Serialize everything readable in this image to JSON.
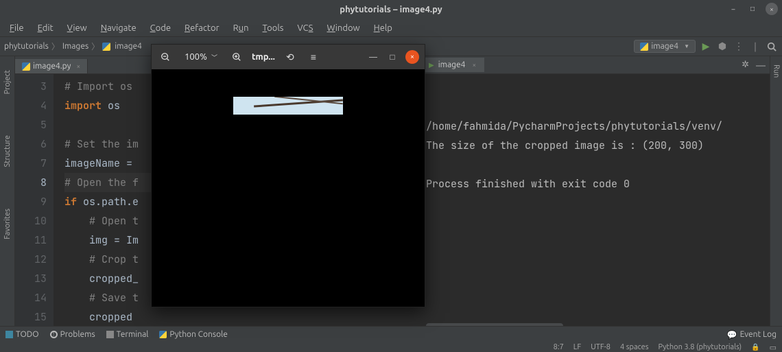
{
  "window": {
    "title": "phytutorials – image4.py",
    "controls": {
      "min": "–",
      "max": "□",
      "close": "×"
    }
  },
  "menu": [
    "File",
    "Edit",
    "View",
    "Navigate",
    "Code",
    "Refactor",
    "Run",
    "Tools",
    "VCS",
    "Window",
    "Help"
  ],
  "breadcrumbs": [
    "phytutorials",
    "Images",
    "image4"
  ],
  "run_config": {
    "label": "image4"
  },
  "editor": {
    "tab": {
      "name": "image4.py"
    },
    "line_start": 3,
    "current_line_index": 5,
    "lines": [
      {
        "t": "cm",
        "text": "# Import os"
      },
      {
        "t": "kw",
        "text": "import",
        "rest": " os"
      },
      {
        "t": "blank",
        "text": ""
      },
      {
        "t": "cm",
        "text": "# Set the im"
      },
      {
        "t": "fn",
        "text": "imageName = "
      },
      {
        "t": "cm",
        "text": "# Open the f"
      },
      {
        "t": "kw",
        "text": "if",
        "rest": " os.path.e"
      },
      {
        "t": "cm",
        "text": "    # Open t"
      },
      {
        "t": "fn",
        "text": "    img = Im"
      },
      {
        "t": "cm",
        "text": "    # Crop t"
      },
      {
        "t": "fn",
        "text": "    cropped_"
      },
      {
        "t": "cm",
        "text": "    # Save t"
      },
      {
        "t": "fn",
        "text": "    cropped"
      }
    ]
  },
  "run_panel": {
    "tab": "image4",
    "output": [
      "/home/fahmida/PycharmProjects/phytutorials/venv/",
      "The size of the cropped image is : (200, 300)",
      "",
      "Process finished with exit code 0"
    ]
  },
  "left_panels": [
    "Project",
    "Structure",
    "Favorites"
  ],
  "right_panels": [
    "Run"
  ],
  "bottom_tools": [
    {
      "icon": "todo",
      "label": "TODO"
    },
    {
      "icon": "prob",
      "label": "Problems"
    },
    {
      "icon": "term",
      "label": "Terminal"
    },
    {
      "icon": "py",
      "label": "Python Console"
    }
  ],
  "event_log": "Event Log",
  "status": {
    "pos": "8:7",
    "le": "LF",
    "enc": "UTF-8",
    "indent": "4 spaces",
    "interp": "Python 3.8 (phytutorials)"
  },
  "viewer": {
    "zoom": "100%",
    "title": "tmp..."
  }
}
